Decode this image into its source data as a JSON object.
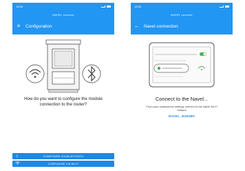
{
  "status_bar": {
    "time": "13:05",
    "icons": [
      "signal-icon",
      "wifi-icon",
      "battery-icon"
    ]
  },
  "brand": {
    "logo_text": "NAVEL connect"
  },
  "screen_config": {
    "title": "Configuration",
    "nav_icon": "hamburger-menu-icon",
    "question": "How do you want to configure the module connection to the router?",
    "buttons": {
      "bluetooth": "CONFIGURE VIA BLUETOOTH",
      "wifi": "CONFIGURE VIA WI-FI"
    }
  },
  "screen_navel": {
    "title": "Navel connection",
    "nav_icon": "back-arrow-icon",
    "heading": "Connect to the Navel...",
    "instruction": "From your smartphone settings connect to the Navel Wi-Fi hotspot",
    "hotspot_name": "NAVEL_B2E0B0"
  },
  "colors": {
    "primary": "#2196f3",
    "button": "#1e88e5",
    "accent_green": "#4caf50"
  }
}
